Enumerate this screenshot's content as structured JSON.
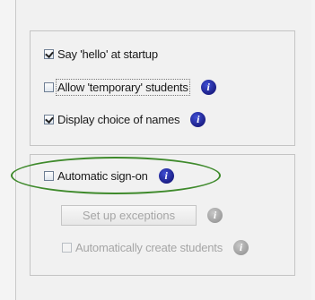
{
  "options": {
    "say_hello": {
      "label": "Say 'hello' at startup",
      "checked": true
    },
    "allow_temporary": {
      "label": "Allow 'temporary' students",
      "checked": false
    },
    "display_names": {
      "label": "Display choice of names",
      "checked": true
    },
    "auto_signon": {
      "label": "Automatic sign-on",
      "checked": false
    },
    "setup_exceptions": {
      "label": "Set up exceptions",
      "enabled": false
    },
    "auto_create": {
      "label": "Automatically create students",
      "checked": false,
      "enabled": false
    }
  },
  "icons": {
    "info": "info-icon",
    "info_glyph": "i"
  },
  "colors": {
    "info_blue": "#1c1f86",
    "highlight_green": "#3f8a2c",
    "disabled_gray": "#a6a6a6"
  }
}
